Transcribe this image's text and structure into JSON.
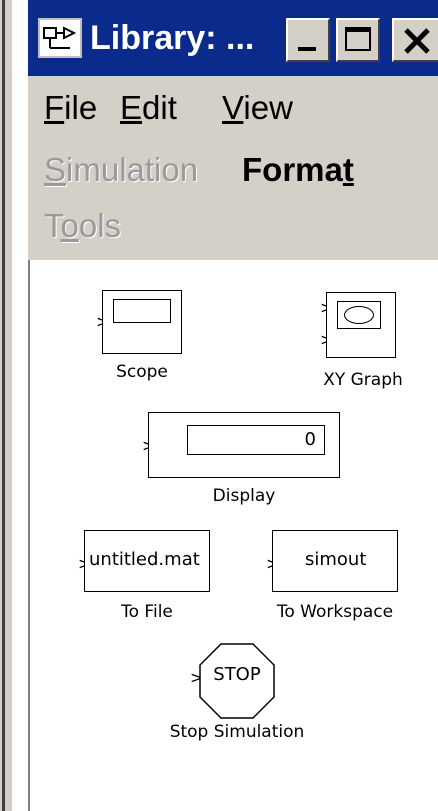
{
  "window": {
    "title": "Library: ...",
    "minimize_glyph": "_",
    "maximize_glyph": "□",
    "close_glyph": "X"
  },
  "menu": {
    "file": {
      "mnemonic": "F",
      "rest": "ile"
    },
    "edit": {
      "mnemonic": "E",
      "rest": "dit"
    },
    "view": {
      "mnemonic": "V",
      "rest": "iew"
    },
    "simulation": {
      "mnemonic": "S",
      "rest": "imulation"
    },
    "format": {
      "pre": "Forma",
      "mnemonic": "t"
    },
    "tools": {
      "pre": "T",
      "mnemonic": "o",
      "rest": "ols"
    }
  },
  "blocks": {
    "scope": {
      "label": "Scope"
    },
    "xy_graph": {
      "label": "XY Graph"
    },
    "display": {
      "label": "Display",
      "value": "0"
    },
    "to_file": {
      "label": "To File",
      "filename": "untitled.mat"
    },
    "to_workspace": {
      "label": "To Workspace",
      "variable": "simout"
    },
    "stop": {
      "label": "Stop Simulation",
      "text": "STOP"
    }
  },
  "colors": {
    "titlebar": "#0a2b8c",
    "chrome": "#d4d0c8",
    "disabled_text": "#9a9a9a"
  }
}
